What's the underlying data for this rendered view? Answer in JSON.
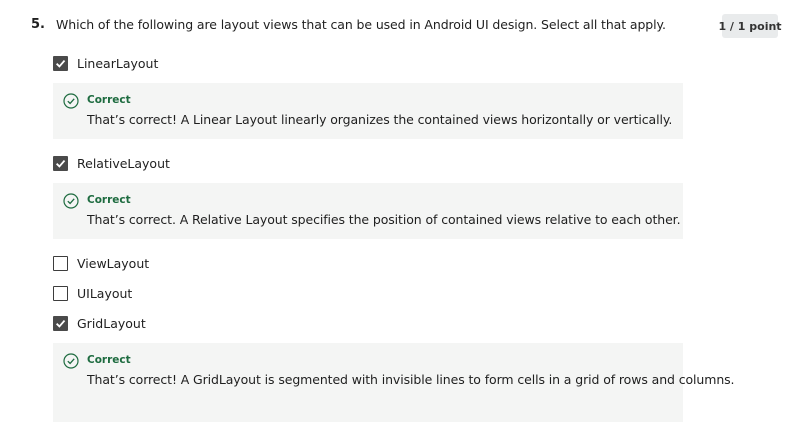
{
  "question": {
    "number": "5.",
    "text": "Which of the following are layout views that can be used in Android UI design. Select all that apply.",
    "points": "1 / 1 point"
  },
  "options": [
    {
      "label": "LinearLayout",
      "checked": true
    },
    {
      "label": "RelativeLayout",
      "checked": true
    },
    {
      "label": "ViewLayout",
      "checked": false
    },
    {
      "label": "UILayout",
      "checked": false
    },
    {
      "label": "GridLayout",
      "checked": true
    }
  ],
  "feedback": [
    {
      "status": "Correct",
      "text": "That’s correct! A Linear Layout linearly organizes the contained views horizontally or vertically."
    },
    {
      "status": "Correct",
      "text": "That’s correct. A Relative Layout specifies the position of contained views relative to each other."
    },
    {
      "status": "Correct",
      "text": "That’s correct! A GridLayout is segmented with invisible lines to form cells in a grid of rows and columns."
    }
  ],
  "colors": {
    "correct_green": "#1d6b3f",
    "checkbox_fill": "#4a4a4a",
    "feedback_bg": "#f4f5f4",
    "badge_bg": "#e9ebec"
  },
  "icons": {
    "checkbox_checked": "check-icon",
    "feedback_status": "check-circle-icon"
  }
}
